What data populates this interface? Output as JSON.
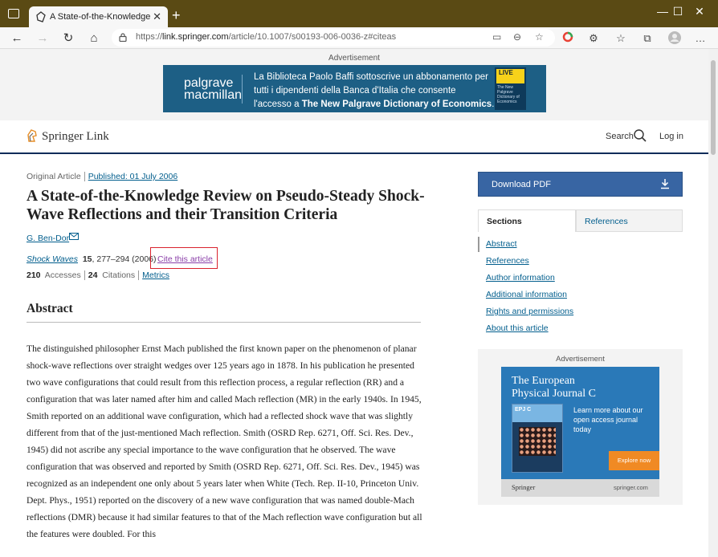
{
  "browser": {
    "tab_title": "A State-of-the-Knowledge Review on Pseudo-Steady Shock-Wave Reflections and their Transition Criteria",
    "tab_title_visible": "A State-of-the-Knowledge Revie",
    "url_prefix": "https://",
    "url_host": "link.springer.com",
    "url_path": "/article/10.1007/s00193-006-0036-z#citeas",
    "window_controls": [
      "minimize",
      "maximize",
      "close"
    ],
    "title_bar_color": "#5a4a14"
  },
  "ad_top": {
    "label": "Advertisement",
    "brand_line1": "palgrave",
    "brand_line2": "macmillan",
    "message_line1": "La Biblioteca Paolo Baffi sottoscrive un abbonamento per",
    "message_line2": "tutti i dipendenti della Banca d'Italia che consente",
    "message_line3_pre": "l'accesso a ",
    "message_line3_bold": "The New Palgrave Dictionary of Economics",
    "message_line3_post": ".",
    "book_badge": "LIVE",
    "book_title": "The New Palgrave Dictionary of Economics",
    "banner_color": "#1d5f85"
  },
  "header": {
    "logo_text": "Springer",
    "logo_link": "Link",
    "search_label": "Search",
    "login_label": "Log in"
  },
  "article": {
    "type": "Original Article",
    "published": "Published: 01 July 2006",
    "title": "A State-of-the-Knowledge Review on Pseudo-Steady Shock-Wave Reflections and their Transition Criteria",
    "author": "G. Ben-Dor",
    "journal": "Shock Waves",
    "volume": "15",
    "pages_year": ", 277–294 (2006)",
    "cite_label": "Cite this article",
    "accesses_count": "210",
    "accesses_label": "Accesses",
    "citations_count": "24",
    "citations_label": "Citations",
    "metrics_label": "Metrics",
    "abstract_heading": "Abstract",
    "abstract_text": "The distinguished philosopher Ernst Mach published the first known paper on the phenomenon of planar shock-wave reflections over straight wedges over 125 years ago in 1878. In his publication he presented two wave configurations that could result from this reflection process, a regular reflection (RR) and a configuration that was later named after him and called Mach reflection (MR) in the early 1940s. In 1945, Smith reported on an additional wave configuration, which had a reflected shock wave that was slightly different from that of the just-mentioned Mach reflection. Smith (OSRD Rep. 6271, Off. Sci. Res. Dev., 1945) did not ascribe any special importance to the wave configuration that he observed. The wave configuration that was observed and reported by Smith (OSRD Rep. 6271, Off. Sci. Res. Dev., 1945) was recognized as an independent one only about 5 years later when White (Tech. Rep. II-10, Princeton Univ. Dept. Phys., 1951) reported on the discovery of a new wave configuration that was named double-Mach reflections (DMR) because it had similar features to that of the Mach reflection wave configuration but all the features were doubled. For this"
  },
  "sidebar": {
    "download_label": "Download PDF",
    "download_color": "#3865a3",
    "tab_sections": "Sections",
    "tab_references": "References",
    "toc": [
      "Abstract",
      "References",
      "Author information",
      "Additional information",
      "Rights and permissions",
      "About this article"
    ]
  },
  "ad_side": {
    "label": "Advertisement",
    "title_line1": "The European",
    "title_line2": "Physical Journal C",
    "cover_label": "EPJ C",
    "subtext": "Learn more about our open access journal today",
    "explore_label": "Explore now",
    "footer_brand": "Springer",
    "footer_site": "springer.com",
    "accent_color": "#2a79b8"
  }
}
